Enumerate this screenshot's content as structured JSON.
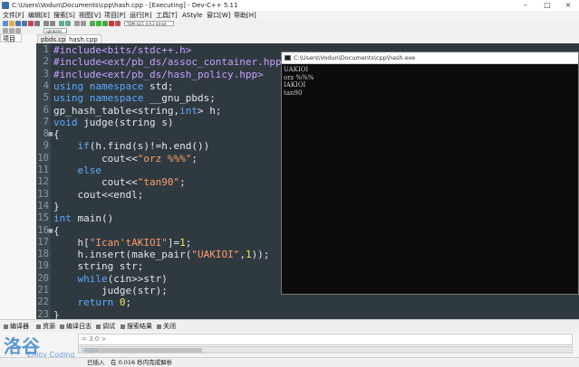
{
  "window": {
    "title": "C:\\Users\\Vodun\\Documents\\cpp\\hash.cpp - [Executing] - Dev-C++ 5.11",
    "controls": [
      "–",
      "□",
      "×"
    ]
  },
  "menu": [
    "文件[F]",
    "编辑[E]",
    "搜索[S]",
    "视图[V]",
    "项目[P]",
    "运行[R]",
    "工具[T]",
    "AStyle",
    "窗口[W]",
    "帮助[H]"
  ],
  "toolbar": {
    "compiler_select": "TDM-GCC 4.9.2 64-bit Release",
    "scope_select": "(globals)"
  },
  "left_panel": {
    "tab": "项目"
  },
  "file_tabs": [
    {
      "label": "pbds.cpp",
      "active": false
    },
    {
      "label": "hash.cpp",
      "active": true
    }
  ],
  "editor": {
    "line_numbers": [
      "1",
      "2",
      "3",
      "4",
      "5",
      "6",
      "7",
      "8",
      "9",
      "10",
      "11",
      "12",
      "13",
      "14",
      "15",
      "16",
      "17",
      "18",
      "19",
      "20",
      "21",
      "22",
      "23"
    ]
  },
  "console": {
    "title": "C:\\Users\\Vodun\\Documents\\cpp\\hash.exe",
    "output": [
      "UAKIOI",
      "orz %%%",
      "IAKIOI",
      "tan90"
    ]
  },
  "bottom_tabs": [
    "编译器",
    "资源",
    "编译日志",
    "调试",
    "搜索结果",
    "关闭"
  ],
  "bottom": {
    "output_text": "= 3.0 >",
    "watermark": "洛谷",
    "watermark_sub": "Enjoy Coding",
    "faint_text": "uogu"
  },
  "status": {
    "state": "已插入",
    "message": "在 0.016 秒内完成解析"
  },
  "colors": {
    "editor_bg": "#2f3a40",
    "keyword": "#5fa9ff",
    "string": "#ff9d6b",
    "number": "#f7e35a",
    "console_bg": "#0c0c0c"
  }
}
